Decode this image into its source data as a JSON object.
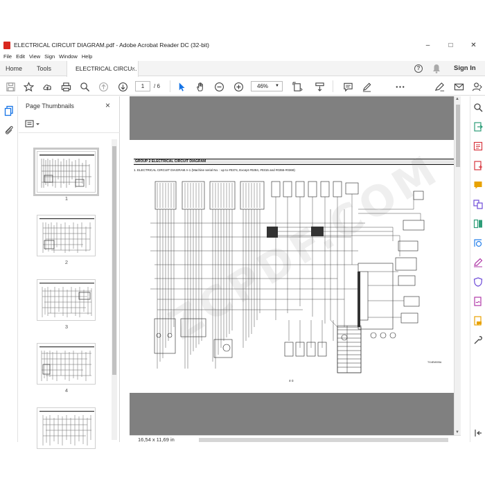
{
  "window": {
    "title": "ELECTRICAL CIRCUIT DIAGRAM.pdf - Adobe Acrobat Reader DC (32-bit)",
    "minimize": "–",
    "maximize": "□",
    "close": "✕"
  },
  "menu": [
    "File",
    "Edit",
    "View",
    "Sign",
    "Window",
    "Help"
  ],
  "tabs": {
    "home": "Home",
    "tools": "Tools",
    "document": "ELECTRICAL CIRCU...",
    "document_close": "×"
  },
  "account": {
    "sign_in": "Sign In",
    "help": "?"
  },
  "toolbar": {
    "current_page": "1",
    "total_pages": "/ 6",
    "zoom": "46%"
  },
  "thumbnails": {
    "header": "Page Thumbnails",
    "close": "×",
    "pages": [
      {
        "label": "1",
        "selected": true
      },
      {
        "label": "2",
        "selected": false
      },
      {
        "label": "3",
        "selected": false
      },
      {
        "label": "4",
        "selected": false
      },
      {
        "label": "",
        "selected": false
      }
    ]
  },
  "document": {
    "group_heading": "GROUP 2 ELECTRICAL CIRCUIT DIAGRAM",
    "subheading": "1. ELECTRICAL CIRCUIT DIAGRAM A-1 (Machine serial No. : up to #0374, Except #0284, #0315 and #0355-#0369)",
    "page_number": "4-3",
    "figure_code": "TG4EM005A",
    "watermark": "ZCPDF.COM"
  },
  "status": {
    "page_size": "16,54 x 11,69 in"
  },
  "colors": {
    "acrobat_red": "#d9271e",
    "panel_bg": "#f4f4f4",
    "doc_bg": "#808080",
    "accent_blue": "#1473e6"
  }
}
